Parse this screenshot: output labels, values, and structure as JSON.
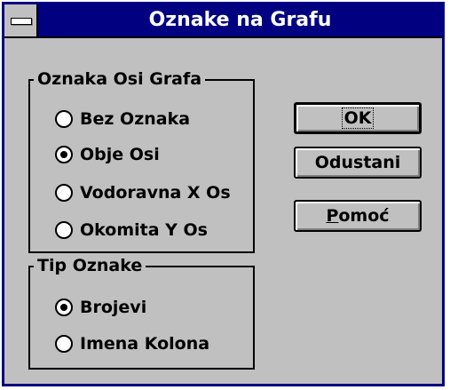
{
  "window": {
    "title": "Oznake na Grafu"
  },
  "axis_group": {
    "legend": "Oznaka Osi Grafa",
    "options": [
      {
        "label": "Bez Oznaka",
        "checked": false
      },
      {
        "label": "Obje Osi",
        "checked": true
      },
      {
        "label": "Vodoravna X Os",
        "checked": false
      },
      {
        "label": "Okomita Y Os",
        "checked": false
      }
    ]
  },
  "type_group": {
    "legend": "Tip Oznake",
    "options": [
      {
        "label": "Brojevi",
        "checked": true
      },
      {
        "label": "Imena Kolona",
        "checked": false
      }
    ]
  },
  "buttons": {
    "ok": "OK",
    "cancel": "Odustani",
    "help_mnemonic": "P",
    "help_rest": "omoć"
  },
  "colors": {
    "titlebar": "#000080",
    "face": "#c0c0c0"
  }
}
